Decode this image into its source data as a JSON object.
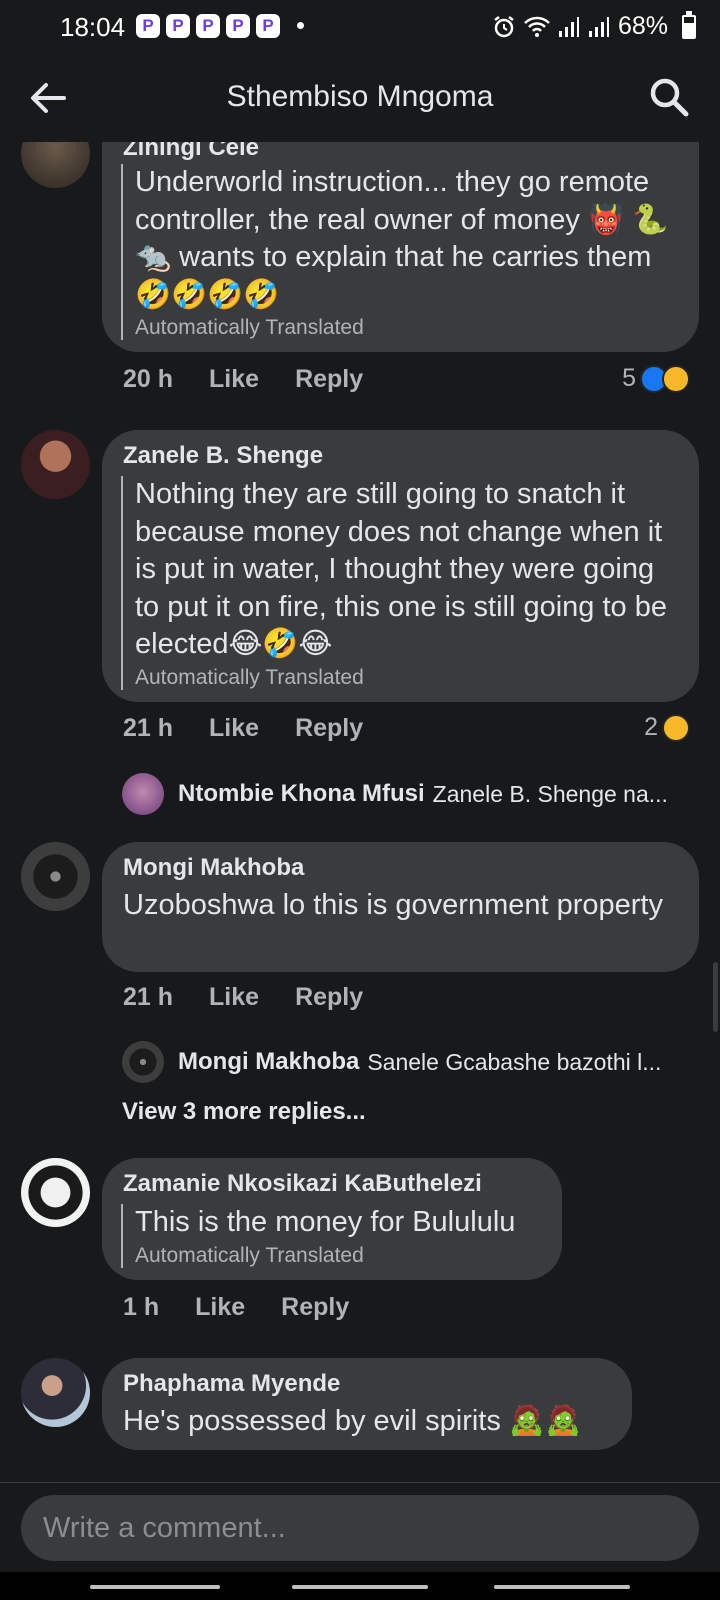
{
  "status_bar": {
    "time": "18:04",
    "notification_apps": [
      "P",
      "P",
      "P",
      "P",
      "P"
    ],
    "battery": "68%",
    "battery_level": 0.68
  },
  "header": {
    "title": "Sthembiso Mngoma",
    "back_icon": "arrow-left-icon",
    "search_icon": "search-icon"
  },
  "comments": [
    {
      "author": "Zihingi Cele",
      "text": "Underworld instruction... they go remote controller, the real owner of money 👹 🐍 🐀 wants to explain that he carries them 🤣🤣🤣🤣",
      "translation_note": "Automatically Translated",
      "time": "20 h",
      "like_label": "Like",
      "reply_label": "Reply",
      "reaction_count": "5"
    },
    {
      "author": "Zanele B. Shenge",
      "text": "Nothing they are still going to snatch it because money does not change when it is put in water, I thought they were going to put it on fire, this one is still going to be elected😂🤣😂",
      "translation_note": "Automatically Translated",
      "time": "21 h",
      "like_label": "Like",
      "reply_label": "Reply",
      "reaction_count": "2",
      "reply_preview": {
        "name": "Ntombie Khona Mfusi",
        "text": "Zanele B. Shenge na..."
      }
    },
    {
      "author": "Mongi Makhoba",
      "text": "Uzoboshwa lo this is government property",
      "time": "21 h",
      "like_label": "Like",
      "reply_label": "Reply",
      "reply_preview": {
        "name": "Mongi Makhoba",
        "text": "Sanele Gcabashe bazothi l..."
      },
      "view_more": "View 3 more replies..."
    },
    {
      "author": "Zamanie Nkosikazi KaButhelezi",
      "text": "This is the money for Bulululu",
      "translation_note": "Automatically Translated",
      "time": "1 h",
      "like_label": "Like",
      "reply_label": "Reply"
    },
    {
      "author": "Phaphama Myende",
      "text": "He's possessed by evil spirits 🧟🧟"
    }
  ],
  "composer": {
    "placeholder": "Write a comment..."
  }
}
